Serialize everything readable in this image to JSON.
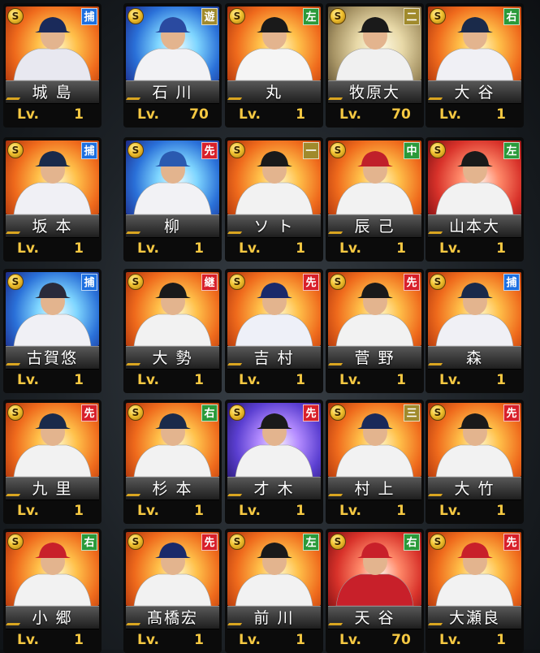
{
  "coin_label": "S",
  "level_prefix": "Lv.",
  "colors": {
    "catcher_badge": "#1c6fe0",
    "infield_badge": "#a08a2c",
    "outfield_badge": "#2a9a3a",
    "pitcher_badge": "#d8202a",
    "level_text": "#f5c842"
  },
  "cards": [
    {
      "name": "城 島",
      "position": "捕",
      "level": "1",
      "bg": "orange",
      "uniform": "#e8e8f0",
      "cap": "#1a2a5a"
    },
    {
      "name": "石 川",
      "position": "遊",
      "level": "70",
      "bg": "blue",
      "uniform": "#f2f2f5",
      "cap": "#2a4aa0"
    },
    {
      "name": "丸",
      "position": "左",
      "level": "1",
      "bg": "orange",
      "uniform": "#f5f5f5",
      "cap": "#1a1a1a"
    },
    {
      "name": "牧原大",
      "position": "二",
      "level": "70",
      "bg": "gold",
      "uniform": "#f0f0f0",
      "cap": "#1a1a1a"
    },
    {
      "name": "大 谷",
      "position": "右",
      "level": "1",
      "bg": "orange",
      "uniform": "#f0f0f5",
      "cap": "#1a2a4a"
    },
    {
      "name": "坂 本",
      "position": "捕",
      "level": "1",
      "bg": "orange",
      "uniform": "#f0f0f5",
      "cap": "#1a2a4a"
    },
    {
      "name": "柳",
      "position": "先",
      "level": "1",
      "bg": "blue",
      "uniform": "#f2f2f5",
      "cap": "#2a5ab0"
    },
    {
      "name": "ソ ト",
      "position": "一",
      "level": "1",
      "bg": "orange",
      "uniform": "#f2f2f2",
      "cap": "#1a1a1a"
    },
    {
      "name": "辰 己",
      "position": "中",
      "level": "1",
      "bg": "orange",
      "uniform": "#f2f2f2",
      "cap": "#c0202a"
    },
    {
      "name": "山本大",
      "position": "左",
      "level": "1",
      "bg": "red",
      "uniform": "#f2f2f2",
      "cap": "#1a1a1a"
    },
    {
      "name": "古賀悠",
      "position": "捕",
      "level": "1",
      "bg": "blue",
      "uniform": "#f0f0f5",
      "cap": "#2a2a3a"
    },
    {
      "name": "大 勢",
      "position": "継",
      "level": "1",
      "bg": "orange",
      "uniform": "#f2f2f2",
      "cap": "#1a1a1a"
    },
    {
      "name": "吉 村",
      "position": "先",
      "level": "1",
      "bg": "orange",
      "uniform": "#eef0f8",
      "cap": "#1a2a6a"
    },
    {
      "name": "菅 野",
      "position": "先",
      "level": "1",
      "bg": "orange",
      "uniform": "#f2f2f2",
      "cap": "#1a1a1a"
    },
    {
      "name": "森",
      "position": "捕",
      "level": "1",
      "bg": "orange",
      "uniform": "#f0f0f5",
      "cap": "#1a2a4a"
    },
    {
      "name": "九 里",
      "position": "先",
      "level": "1",
      "bg": "orange",
      "uniform": "#f2f2f2",
      "cap": "#1a2a4a"
    },
    {
      "name": "杉 本",
      "position": "右",
      "level": "1",
      "bg": "orange",
      "uniform": "#f2f2f2",
      "cap": "#1a2a4a"
    },
    {
      "name": "才 木",
      "position": "先",
      "level": "1",
      "bg": "purple",
      "uniform": "#f2f2f2",
      "cap": "#1a1a1a"
    },
    {
      "name": "村 上",
      "position": "三",
      "level": "1",
      "bg": "orange",
      "uniform": "#f2f2f2",
      "cap": "#1a2a5a"
    },
    {
      "name": "大 竹",
      "position": "先",
      "level": "1",
      "bg": "orange",
      "uniform": "#f2f2f2",
      "cap": "#1a1a1a"
    },
    {
      "name": "小 郷",
      "position": "右",
      "level": "1",
      "bg": "orange",
      "uniform": "#f2f2f2",
      "cap": "#c8202a"
    },
    {
      "name": "髙橋宏",
      "position": "先",
      "level": "1",
      "bg": "orange",
      "uniform": "#f2f2f2",
      "cap": "#1a2a6a"
    },
    {
      "name": "前 川",
      "position": "左",
      "level": "1",
      "bg": "orange",
      "uniform": "#f2f2f2",
      "cap": "#1a1a1a"
    },
    {
      "name": "天 谷",
      "position": "右",
      "level": "70",
      "bg": "red",
      "uniform": "#c8202a",
      "cap": "#c8202a"
    },
    {
      "name": "大瀬良",
      "position": "先",
      "level": "1",
      "bg": "orange",
      "uniform": "#f2f2f2",
      "cap": "#c8202a"
    }
  ]
}
